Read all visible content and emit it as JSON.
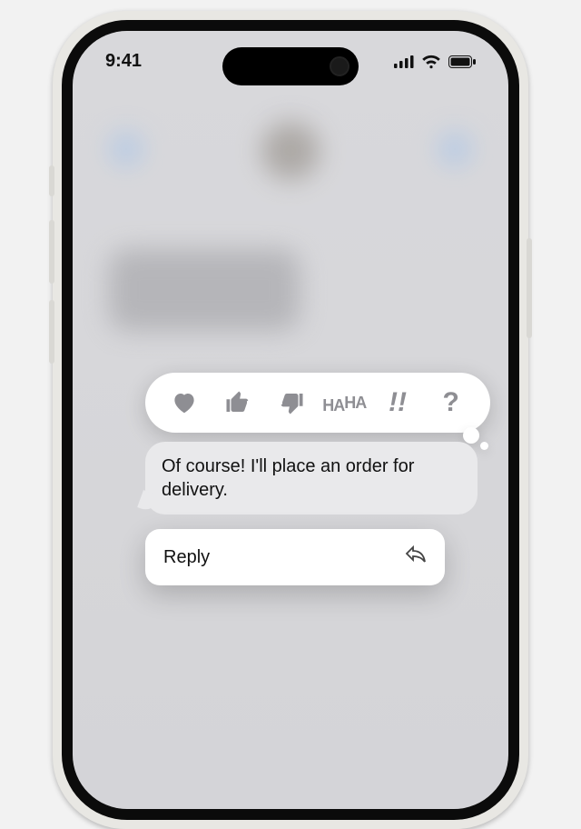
{
  "status": {
    "time": "9:41"
  },
  "tapbacks": [
    {
      "name": "heart"
    },
    {
      "name": "thumbs-up"
    },
    {
      "name": "thumbs-down"
    },
    {
      "name": "haha"
    },
    {
      "name": "exclaim"
    },
    {
      "name": "question"
    }
  ],
  "message": {
    "text": "Of course! I'll place an order for delivery."
  },
  "menu": {
    "reply": "Reply"
  }
}
